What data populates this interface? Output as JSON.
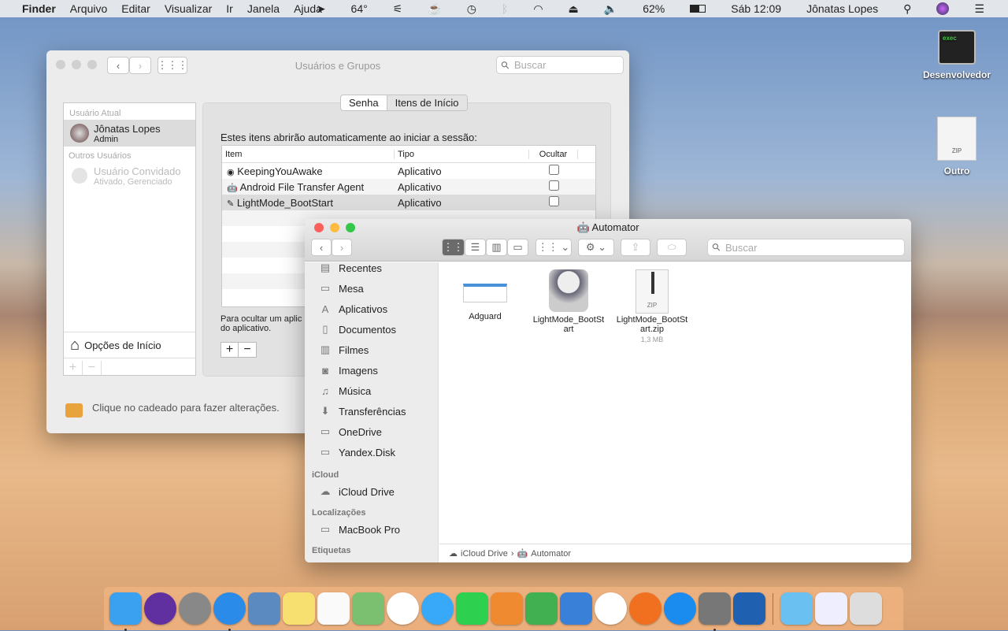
{
  "menubar": {
    "app": "Finder",
    "items": [
      "Arquivo",
      "Editar",
      "Visualizar",
      "Ir",
      "Janela",
      "Ajuda"
    ],
    "temperature": "64°",
    "battery": "62%",
    "clock": "Sáb 12:09",
    "user": "Jônatas Lopes"
  },
  "desktop": {
    "icons": [
      {
        "label": "Desenvolvedor",
        "glyph": "exec"
      },
      {
        "label": "Outro",
        "glyph": "ZIP"
      }
    ]
  },
  "prefs": {
    "title": "Usuários e Grupos",
    "search_placeholder": "Buscar",
    "sidebar": {
      "current_header": "Usuário Atual",
      "current_name": "Jônatas Lopes",
      "current_role": "Admin",
      "others_header": "Outros Usuários",
      "guest_name": "Usuário Convidado",
      "guest_status": "Ativado, Gerenciado",
      "login_options": "Opções de Início"
    },
    "tabs": [
      "Senha",
      "Itens de Início"
    ],
    "active_tab": 1,
    "description": "Estes itens abrirão automaticamente ao iniciar a sessão:",
    "columns": [
      "Item",
      "Tipo",
      "Ocultar"
    ],
    "rows": [
      {
        "item": "KeepingYouAwake",
        "type": "Aplicativo",
        "hidden": false
      },
      {
        "item": "Android File Transfer Agent",
        "type": "Aplicativo",
        "hidden": false
      },
      {
        "item": "LightMode_BootStart",
        "type": "Aplicativo",
        "hidden": false
      }
    ],
    "hint_line1": "Para ocultar um aplic",
    "hint_line2": "do aplicativo.",
    "lock_text": "Clique no cadeado para fazer alterações."
  },
  "finder": {
    "title": "Automator",
    "search_placeholder": "Buscar",
    "favorites": [
      {
        "label": "Recentes",
        "icon": "recents-icon",
        "g": "▤"
      },
      {
        "label": "Mesa",
        "icon": "desktop-icon",
        "g": "▭"
      },
      {
        "label": "Aplicativos",
        "icon": "applications-icon",
        "g": "A"
      },
      {
        "label": "Documentos",
        "icon": "documents-icon",
        "g": "▯"
      },
      {
        "label": "Filmes",
        "icon": "movies-icon",
        "g": "▥"
      },
      {
        "label": "Imagens",
        "icon": "pictures-icon",
        "g": "◙"
      },
      {
        "label": "Música",
        "icon": "music-icon",
        "g": "♫"
      },
      {
        "label": "Transferências",
        "icon": "downloads-icon",
        "g": "⬇"
      },
      {
        "label": "OneDrive",
        "icon": "folder-icon",
        "g": "▭"
      },
      {
        "label": "Yandex.Disk",
        "icon": "folder-icon",
        "g": "▭"
      }
    ],
    "icloud_header": "iCloud",
    "icloud": [
      {
        "label": "iCloud Drive",
        "icon": "cloud-icon",
        "g": "☁"
      }
    ],
    "locations_header": "Localizações",
    "locations": [
      {
        "label": "MacBook Pro",
        "icon": "laptop-icon",
        "g": "▭"
      }
    ],
    "tags_header": "Etiquetas",
    "files": [
      {
        "name": "Adguard",
        "size": ""
      },
      {
        "name": "LightMode_BootSt art",
        "size": ""
      },
      {
        "name": "LightMode_BootSt art.zip",
        "size": "1,3 MB"
      }
    ],
    "path": [
      "iCloud Drive",
      "Automator"
    ]
  },
  "dock": [
    "Finder",
    "Siri",
    "Launchpad",
    "Safari",
    "Mail",
    "Notas",
    "Lembretes",
    "Mapas",
    "Fotos",
    "Mensagens",
    "FaceTime",
    "Pages",
    "Numbers",
    "Keynote",
    "iTunes",
    "iBooks",
    "App Store",
    "Preferências do Sistema",
    "Rosetta Stone",
    "Transferências",
    "Documento",
    "Lixo"
  ]
}
